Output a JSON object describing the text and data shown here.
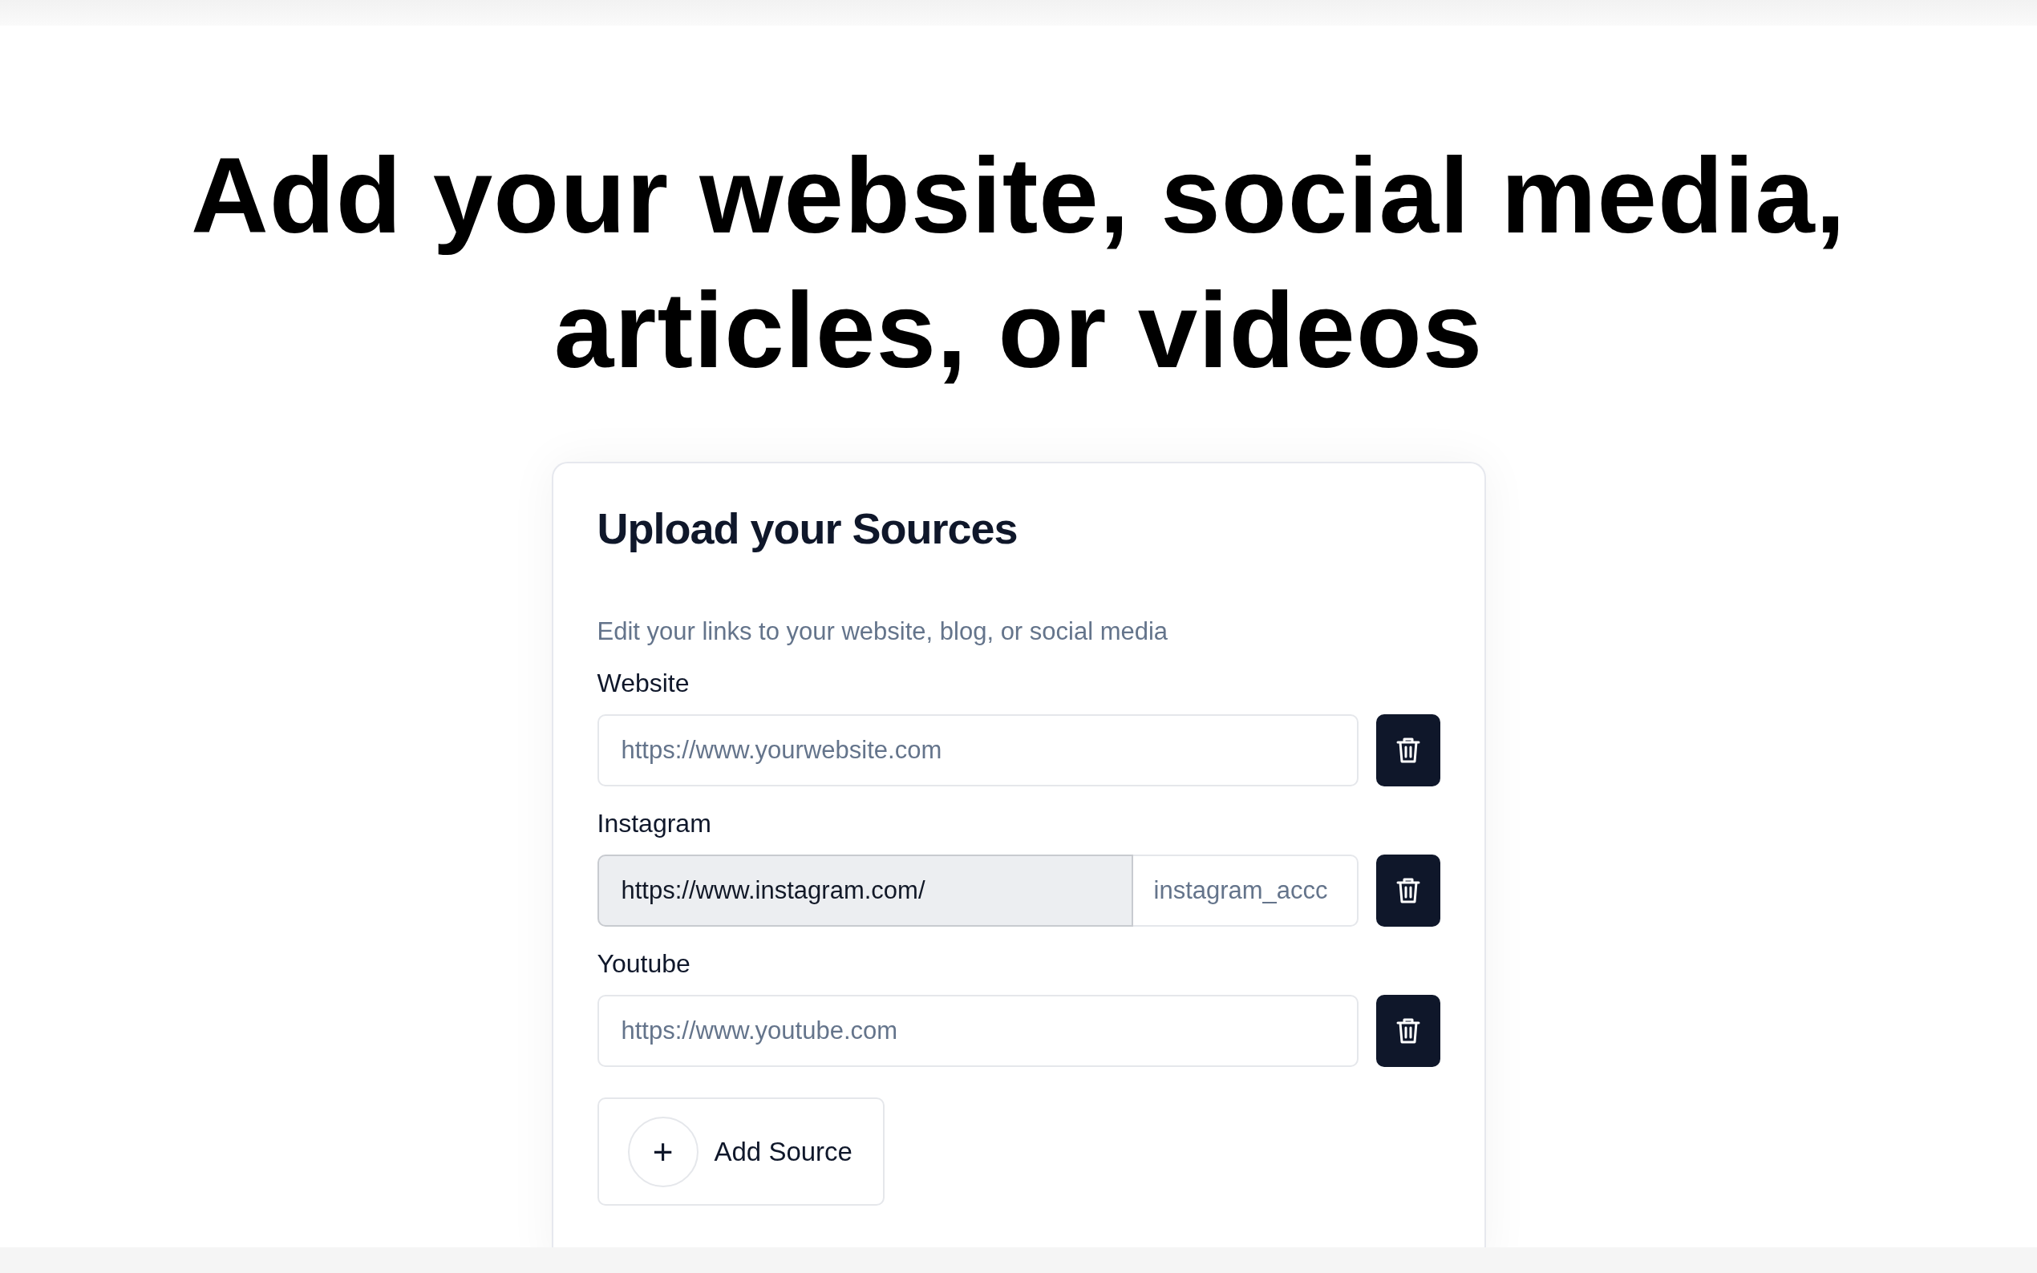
{
  "headline": "Add your website, social media, articles, or videos",
  "card": {
    "title": "Upload your Sources",
    "subtitle": "Edit your links to your website, blog, or social media",
    "sources": [
      {
        "kind": "plain",
        "label": "Website",
        "placeholder": "https://www.yourwebsite.com"
      },
      {
        "kind": "prefixed",
        "label": "Instagram",
        "prefix": "https://www.instagram.com/",
        "placeholder": "instagram_accc"
      },
      {
        "kind": "plain",
        "label": "Youtube",
        "placeholder": "https://www.youtube.com"
      }
    ],
    "add_button": {
      "label": "Add Source",
      "icon": "+"
    }
  }
}
